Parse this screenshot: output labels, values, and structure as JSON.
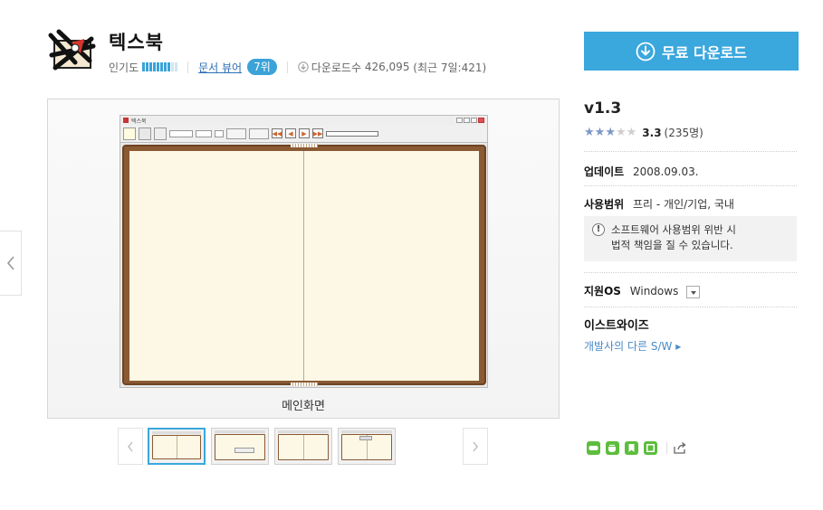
{
  "app": {
    "title": "텍스북",
    "popularity_label": "인기도",
    "popularity_level": 0.75,
    "viewer_link": "문서 뷰어",
    "rank": "7위",
    "downloads_label": "다운로드수",
    "downloads_count": "426,095",
    "recent_downloads": "(최근 7일:421)"
  },
  "download_button": {
    "label": "무료 다운로드",
    "color": "#3aa7dd"
  },
  "viewer": {
    "caption": "메인화면",
    "thumbnails": [
      "main-screen",
      "dialog-screen",
      "book-screen",
      "tool-screen"
    ],
    "active_thumbnail": 0
  },
  "info": {
    "version": "v1.3",
    "rating_score": "3.3",
    "rating_count": "(235명)",
    "rating_stars": 3.3,
    "update_label": "업데이트",
    "update_date": "2008.09.03.",
    "license_label": "사용범위",
    "license_value": "프리 - 개인/기업, 국내",
    "notice_line1": "소프트웨어 사용범위 위반 시",
    "notice_line2": "법적 책임을 질 수 있습니다.",
    "os_label": "지원OS",
    "os_value": "Windows",
    "developer": "이스트와이즈",
    "developer_link": "개발사의 다른 S/W ▸"
  },
  "share": {
    "icons": [
      "blog-icon",
      "cafe-icon",
      "bookmark-icon",
      "memo-icon",
      "share-icon"
    ]
  }
}
